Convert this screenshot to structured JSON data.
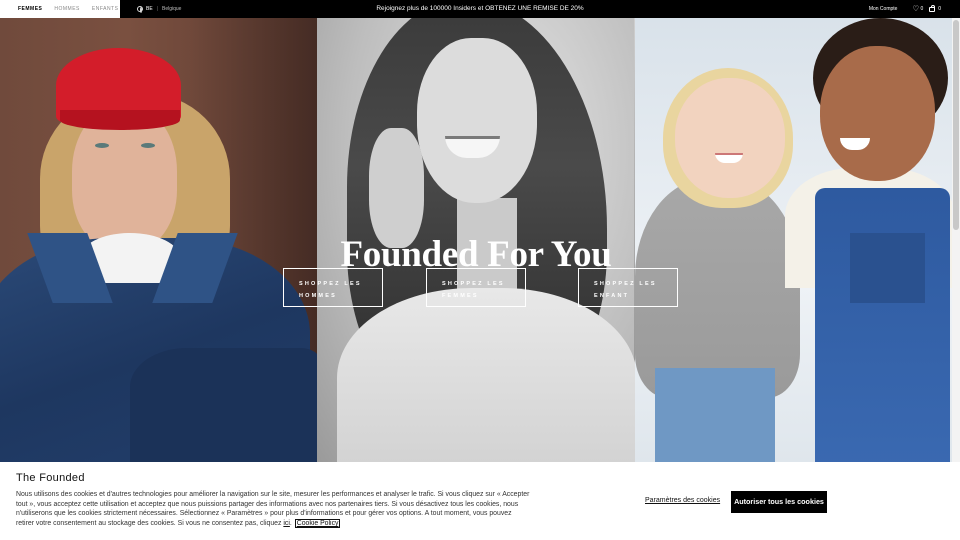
{
  "header": {
    "gender_tabs": [
      {
        "label": "FEMMES",
        "active": true
      },
      {
        "label": "HOMMES",
        "active": false
      },
      {
        "label": "ENFANTS",
        "active": false
      }
    ],
    "country": {
      "code": "BE",
      "name": "Belgique",
      "icon": "globe-icon"
    },
    "promo": "Rejoignez plus de 100000 Insiders et OBTENEZ UNE REMISE DE 20%",
    "account_label": "Mon Compte",
    "wishlist_count": "0",
    "cart_count": "0"
  },
  "hero": {
    "headline": "Founded For You",
    "ctas": [
      {
        "line1": "SHOPPEZ LES",
        "line2": "HOMMES"
      },
      {
        "line1": "SHOPPEZ LES",
        "line2": "FEMMES"
      },
      {
        "line1": "SHOPPEZ LES",
        "line2": "ENFANT"
      }
    ]
  },
  "cookie_banner": {
    "title": "The Founded",
    "text": "Nous utilisons des cookies et d'autres technologies pour améliorer la navigation sur le site, mesurer les performances et analyser le trafic. Si vous cliquez sur « Accepter tout », vous acceptez cette utilisation et acceptez que nous puissions partager des informations avec nos partenaires tiers. Si vous désactivez tous les cookies, nous n'utiliserons que les cookies strictement nécessaires. Sélectionnez « Paramètres » pour plus d'informations et pour gérer vos options. A tout moment, vous pouvez retirer votre consentement au stockage des cookies. Si vous ne consentez pas, cliquez",
    "here_link": "ici",
    "policy_link": "Cookie Policy",
    "settings_label": "Paramètres des cookies",
    "accept_label": "Autoriser tous les cookies"
  }
}
